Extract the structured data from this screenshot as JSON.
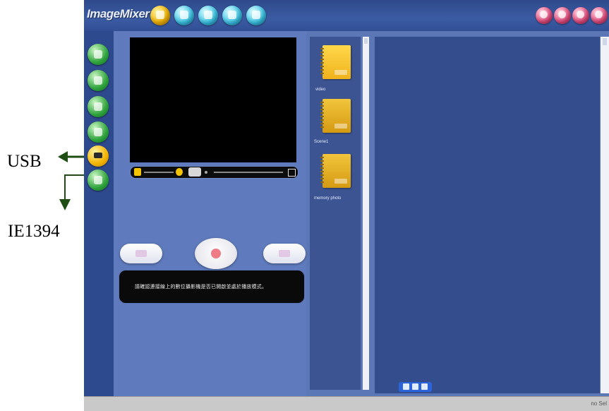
{
  "annotations": {
    "usb_label": "USB",
    "ie1394_label": "IE1394",
    "arrow_color": "#1f4d14"
  },
  "app": {
    "title": "ImageMixer",
    "toolbar_icons": [
      "capture-icon",
      "camera-icon",
      "edit-icon",
      "output-icon",
      "disc-icon"
    ],
    "window_icons": [
      "help-icon",
      "info-icon",
      "minimize-icon",
      "close-icon"
    ],
    "sidebar_icons": [
      "mode-1-icon",
      "mode-2-icon",
      "mode-3-icon",
      "mode-4-icon",
      "usb-icon",
      "ieee1394-icon"
    ],
    "sidebar_active_index": 4,
    "colors": {
      "accent_yellow": "#f2b300",
      "accent_cyan": "#3cc6e8",
      "accent_pink": "#e84e80",
      "accent_green": "#2fa33c",
      "panel_blue": "#344d8c"
    }
  },
  "player": {
    "message": "請確認連接線上的數位攝影機是否已開啟並處於播放模式。"
  },
  "albums": [
    {
      "label": "video"
    },
    {
      "label": "Scene1"
    },
    {
      "label": "memory photo"
    }
  ],
  "status": {
    "text": "no Sel"
  }
}
